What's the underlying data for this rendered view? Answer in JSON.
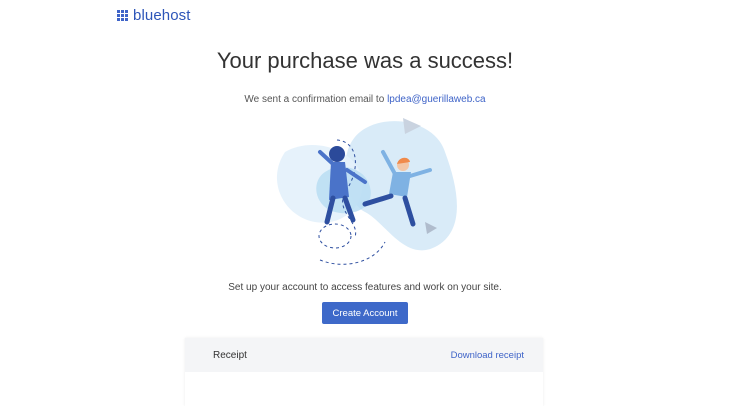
{
  "brand": {
    "name": "bluehost",
    "color": "#2d55b8"
  },
  "page": {
    "title": "Your purchase was a success!",
    "confirm_prefix": "We sent a confirmation email to",
    "email": "lpdea@guerillaweb.ca",
    "setup_text": "Set up your account to access features and work on your site.",
    "create_button": "Create Account"
  },
  "receipt": {
    "title": "Receipt",
    "download_link": "Download receipt"
  },
  "colors": {
    "accent": "#3e69c9",
    "link": "#3f64c8",
    "card_header": "#f4f5f7"
  },
  "icons": [
    "bluehost-logo-icon",
    "celebration-illustration"
  ]
}
